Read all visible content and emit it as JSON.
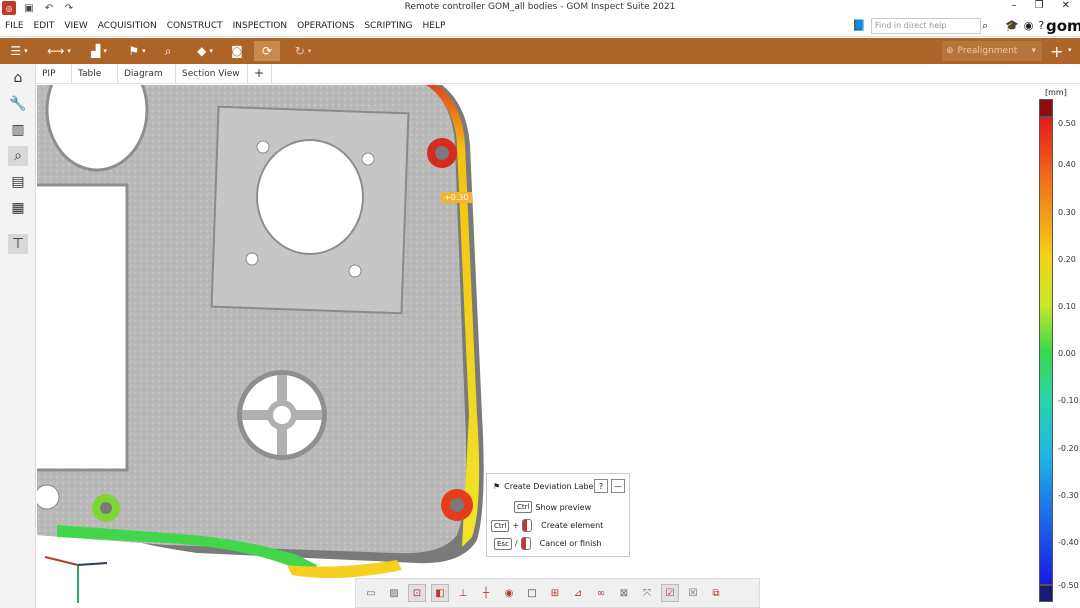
{
  "window": {
    "title": "Remote controller GOM_all bodies - GOM Inspect Suite 2021",
    "controls": [
      "–",
      "❐",
      "✕"
    ]
  },
  "menu": [
    "FILE",
    "EDIT",
    "VIEW",
    "ACQUISITION",
    "CONSTRUCT",
    "INSPECTION",
    "OPERATIONS",
    "SCRIPTING",
    "HELP"
  ],
  "help": {
    "placeholder": "Find in direct help"
  },
  "brand": {
    "logo": "gom"
  },
  "toolbar": {
    "prealignment_label": "Prealignment",
    "accent_color": "#ad6527"
  },
  "tabs": [
    "PIP",
    "Table",
    "Diagram",
    "Section View",
    "+"
  ],
  "scale": {
    "unit": "[mm]",
    "ticks": [
      "0.50",
      "0.40",
      "0.30",
      "0.20",
      "0.10",
      "0.00",
      "-0.10",
      "-0.20",
      "-0.30",
      "-0.40",
      "-0.50"
    ]
  },
  "deviation_label": "+0.30",
  "popup": {
    "title": "Create Deviation Label",
    "help": "?",
    "minimize": "—",
    "key_ctrl": "Ctrl",
    "key_esc": "Esc",
    "plus": "+",
    "slash": "/",
    "show_preview": "Show preview",
    "create_element": "Create element",
    "cancel_finish": "Cancel or finish"
  }
}
